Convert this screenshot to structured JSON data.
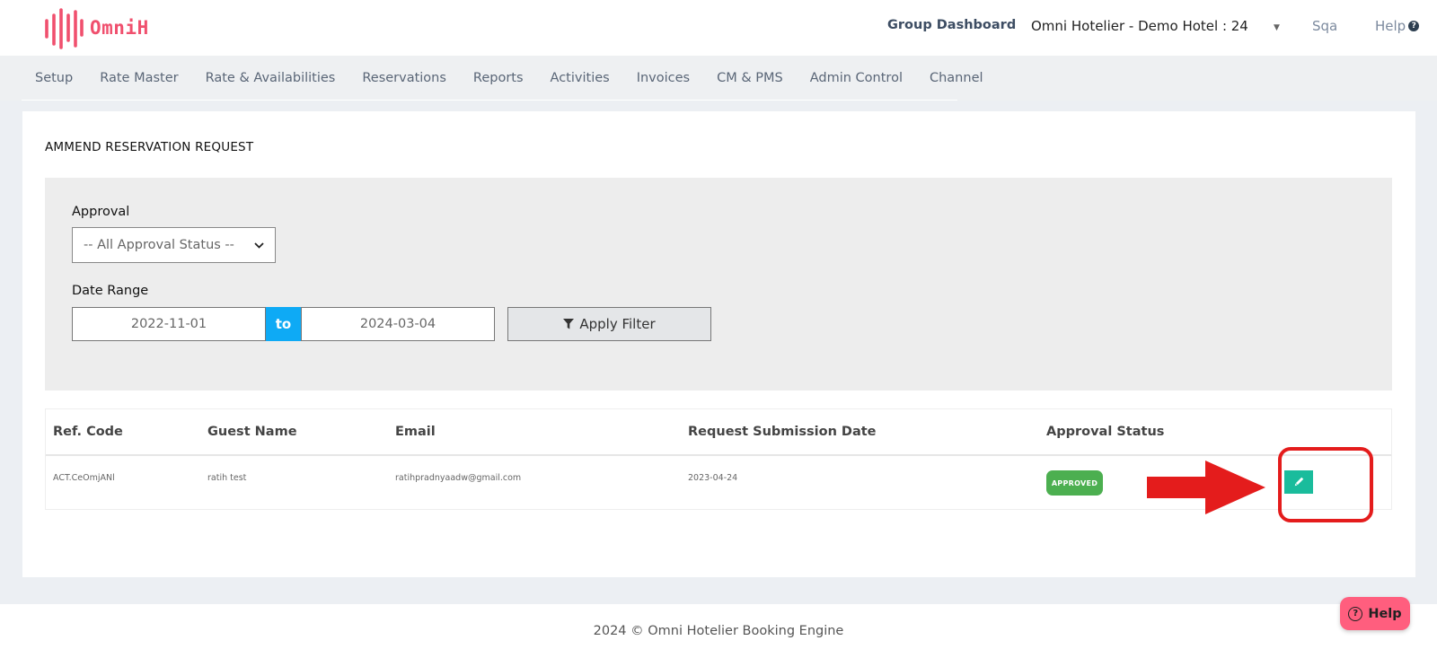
{
  "header": {
    "logo_text": "OmniH",
    "group_dashboard": "Group Dashboard",
    "hotel_selector": "Omni Hotelier - Demo Hotel : 24",
    "user": "Sqa",
    "help": "Help"
  },
  "nav": {
    "items": [
      "Setup",
      "Rate Master",
      "Rate & Availabilities",
      "Reservations",
      "Reports",
      "Activities",
      "Invoices",
      "CM & PMS",
      "Admin Control",
      "Channel"
    ]
  },
  "page": {
    "title": "AMMEND RESERVATION REQUEST"
  },
  "filter": {
    "approval_label": "Approval",
    "approval_selected": "-- All Approval Status --",
    "date_range_label": "Date Range",
    "date_from": "2022-11-01",
    "date_to_label": "to",
    "date_to": "2024-03-04",
    "apply_label": "Apply Filter"
  },
  "table": {
    "headers": [
      "Ref. Code",
      "Guest Name",
      "Email",
      "Request Submission Date",
      "Approval Status"
    ],
    "rows": [
      {
        "ref_code": "ACT.CeOmjANl",
        "guest_name": "ratih test",
        "email": "ratihpradnyaadw@gmail.com",
        "submission_date": "2023-04-24",
        "status": "APPROVED"
      }
    ]
  },
  "footer": {
    "text": "2024 © Omni Hotelier Booking Engine",
    "help_button": "Help"
  },
  "colors": {
    "brand": "#f0506e",
    "accent_blue": "#0eaaf5",
    "approved": "#4caf50",
    "edit": "#1abc9c",
    "annotation": "#e41c1c"
  }
}
